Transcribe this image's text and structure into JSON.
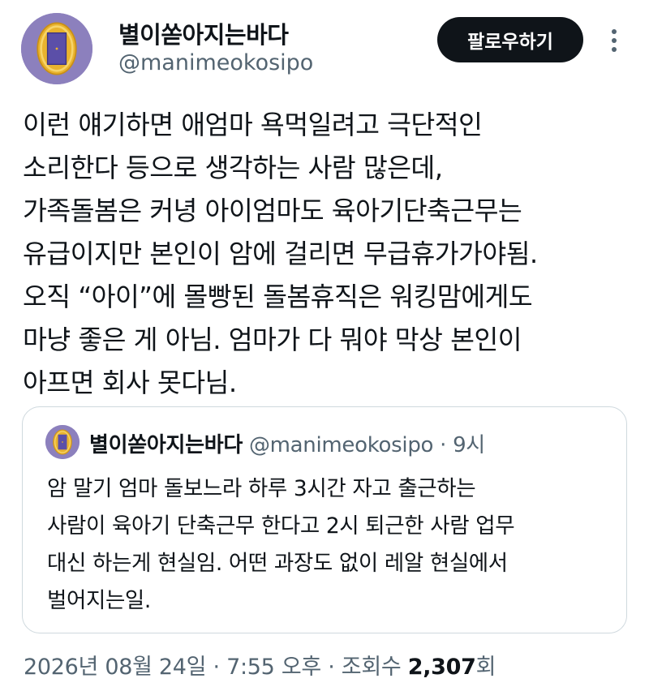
{
  "author": {
    "display_name": "별이쏟아지는바다",
    "handle": "@manimeokosipo"
  },
  "actions": {
    "follow_label": "팔로우하기",
    "more_icon": "more-vertical-icon"
  },
  "tweet": {
    "lines": [
      "이런 얘기하면 애엄마 욕먹일려고 극단적인",
      "소리한다 등으로 생각하는 사람 많은데,",
      "가족돌봄은 커녕 아이엄마도 육아기단축근무는",
      "유급이지만 본인이 암에 걸리면 무급휴가가야됨.",
      "오직 “아이”에 몰빵된 돌봄휴직은 워킹맘에게도",
      "마냥 좋은 게 아님. 엄마가 다 뭐야 막상 본인이",
      "아프면 회사 못다님."
    ]
  },
  "quoted_tweet": {
    "display_name": "별이쏟아지는바다",
    "handle": "@manimeokosipo",
    "separator": "·",
    "time": "9시",
    "lines": [
      "암 말기 엄마 돌보느라 하루 3시간 자고 출근하는",
      "사람이 육아기 단축근무 한다고 2시 퇴근한 사람 업무",
      "대신 하는게 현실임. 어떤 과장도 없이 레알 현실에서",
      "벌어지는일."
    ]
  },
  "meta": {
    "date": "2026년 08월 24일",
    "separator": "·",
    "time": "7:55 오후",
    "views_label": "조회수",
    "views_count": "2,307",
    "views_suffix": "회"
  },
  "colors": {
    "avatar_bg": "#8c80bd",
    "frame": "#e9b32e",
    "door": "#5b4fa8",
    "button_bg": "#0f1419",
    "secondary_text": "#536471",
    "border": "#cfd9de"
  }
}
